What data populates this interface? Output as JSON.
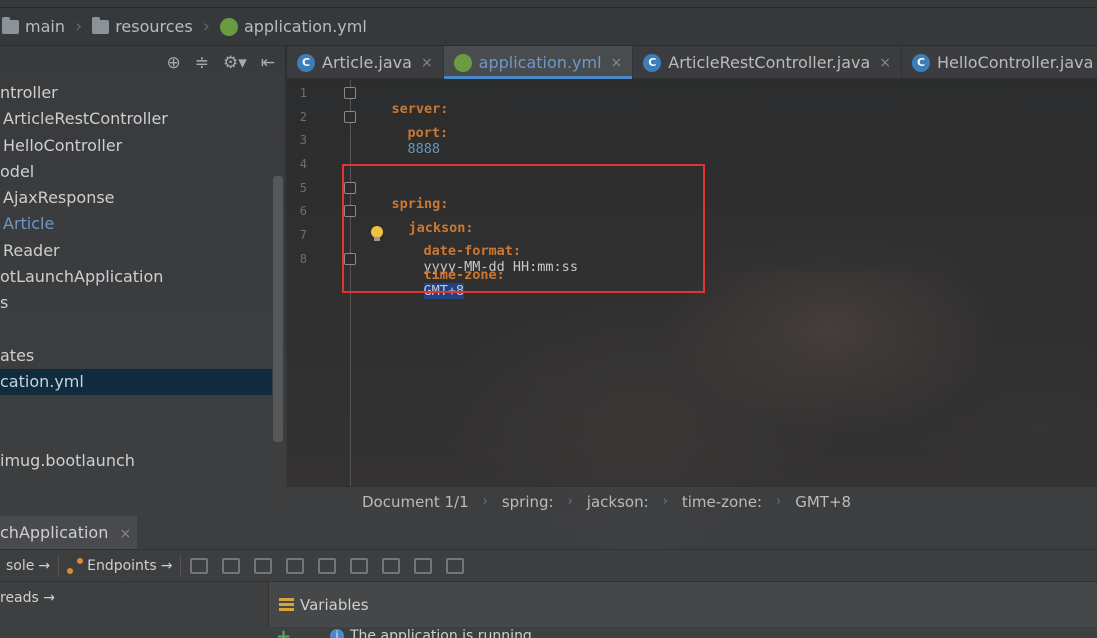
{
  "breadcrumb": {
    "items": [
      "main",
      "resources",
      "application.yml"
    ]
  },
  "project_tree": {
    "items": [
      {
        "label": "ntroller"
      },
      {
        "label": "ArticleRestController"
      },
      {
        "label": "HelloController"
      },
      {
        "label": "odel"
      },
      {
        "label": "AjaxResponse"
      },
      {
        "label": "Article"
      },
      {
        "label": "Reader"
      },
      {
        "label": "otLaunchApplication"
      },
      {
        "label": "s"
      },
      {
        "label": "ates"
      },
      {
        "label": "cation.yml"
      },
      {
        "label": "imug.bootlaunch"
      }
    ]
  },
  "tabs": [
    {
      "label": "Article.java",
      "close": "×"
    },
    {
      "label": "application.yml",
      "close": "×"
    },
    {
      "label": "ArticleRestController.java",
      "close": "×"
    },
    {
      "label": "HelloController.java",
      "close": "×"
    }
  ],
  "editor": {
    "lines": [
      "1",
      "2",
      "3",
      "4",
      "5",
      "6",
      "7",
      "8"
    ],
    "code": {
      "server_key": "server:",
      "port_key": "port:",
      "port_val": "8888",
      "spring_key": "spring:",
      "jackson_key": "jackson:",
      "date_format_key": "date-format:",
      "date_format_val": "yyyy-MM-dd HH:mm:ss",
      "time_zone_key": "time-zone:",
      "time_zone_val": "GMT+8"
    }
  },
  "editor_breadcrumb": [
    "Document 1/1",
    "spring:",
    "jackson:",
    "time-zone:",
    "GMT+8"
  ],
  "run_panel": {
    "tab_label": "chApplication",
    "tab_close": "×",
    "console_label": "sole",
    "endpoints_label": "Endpoints",
    "threads_label": "reads",
    "variables_label": "Variables",
    "status_message": "The application is running"
  },
  "colors": {
    "accent": "#4a88c7",
    "yaml_key": "#cc7832",
    "yaml_number": "#6897bb",
    "highlight_box": "#e03535",
    "selection": "#214283"
  }
}
